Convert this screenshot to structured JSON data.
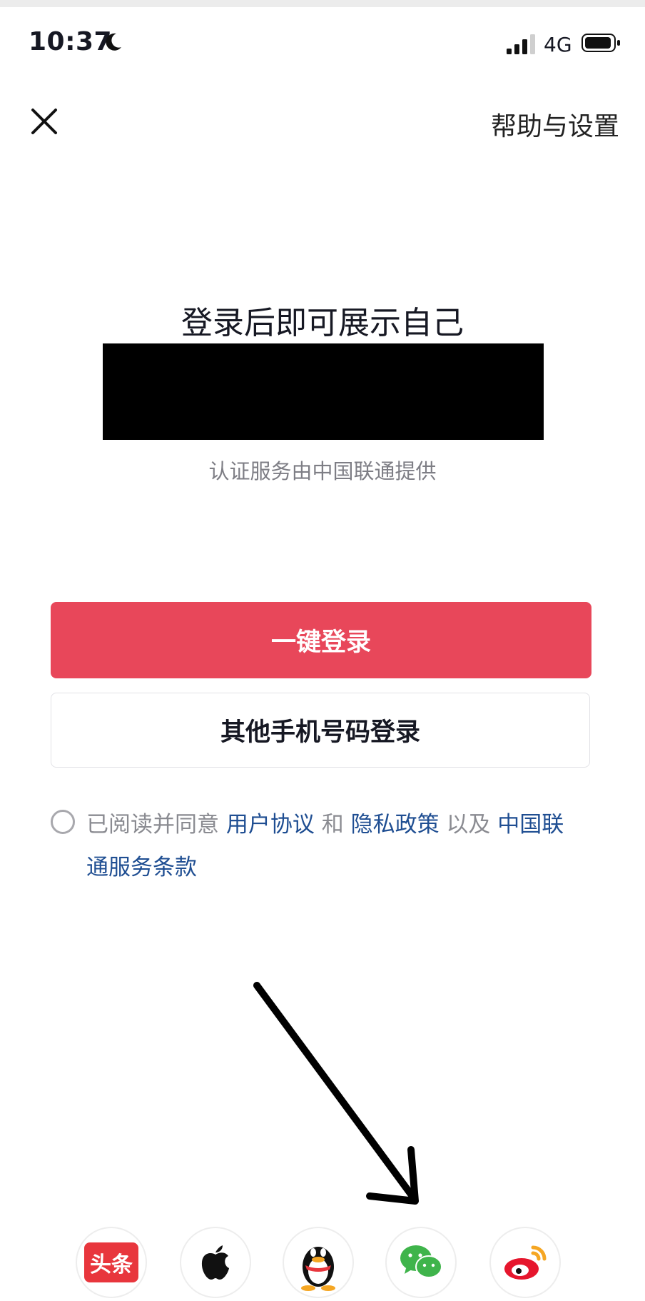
{
  "status_bar": {
    "time": "10:37",
    "network": "4G"
  },
  "header": {
    "help_label": "帮助与设置"
  },
  "login": {
    "title": "登录后即可展示自己",
    "provider_note": "认证服务由中国联通提供"
  },
  "buttons": {
    "one_click": "一键登录",
    "other_phone": "其他手机号码登录"
  },
  "agreement": {
    "prefix": "已阅读并同意 ",
    "user_agreement": "用户协议",
    "and": " 和 ",
    "privacy_policy": "隐私政策",
    "also": " 以及 ",
    "carrier_terms": "中国联通服务条款"
  },
  "social": {
    "toutiao_label": "头条",
    "items": [
      "toutiao-icon",
      "apple-icon",
      "qq-icon",
      "wechat-icon",
      "weibo-icon"
    ]
  },
  "colors": {
    "primary": "#e8475a",
    "link": "#1f4e92",
    "muted": "#8a8b91"
  }
}
